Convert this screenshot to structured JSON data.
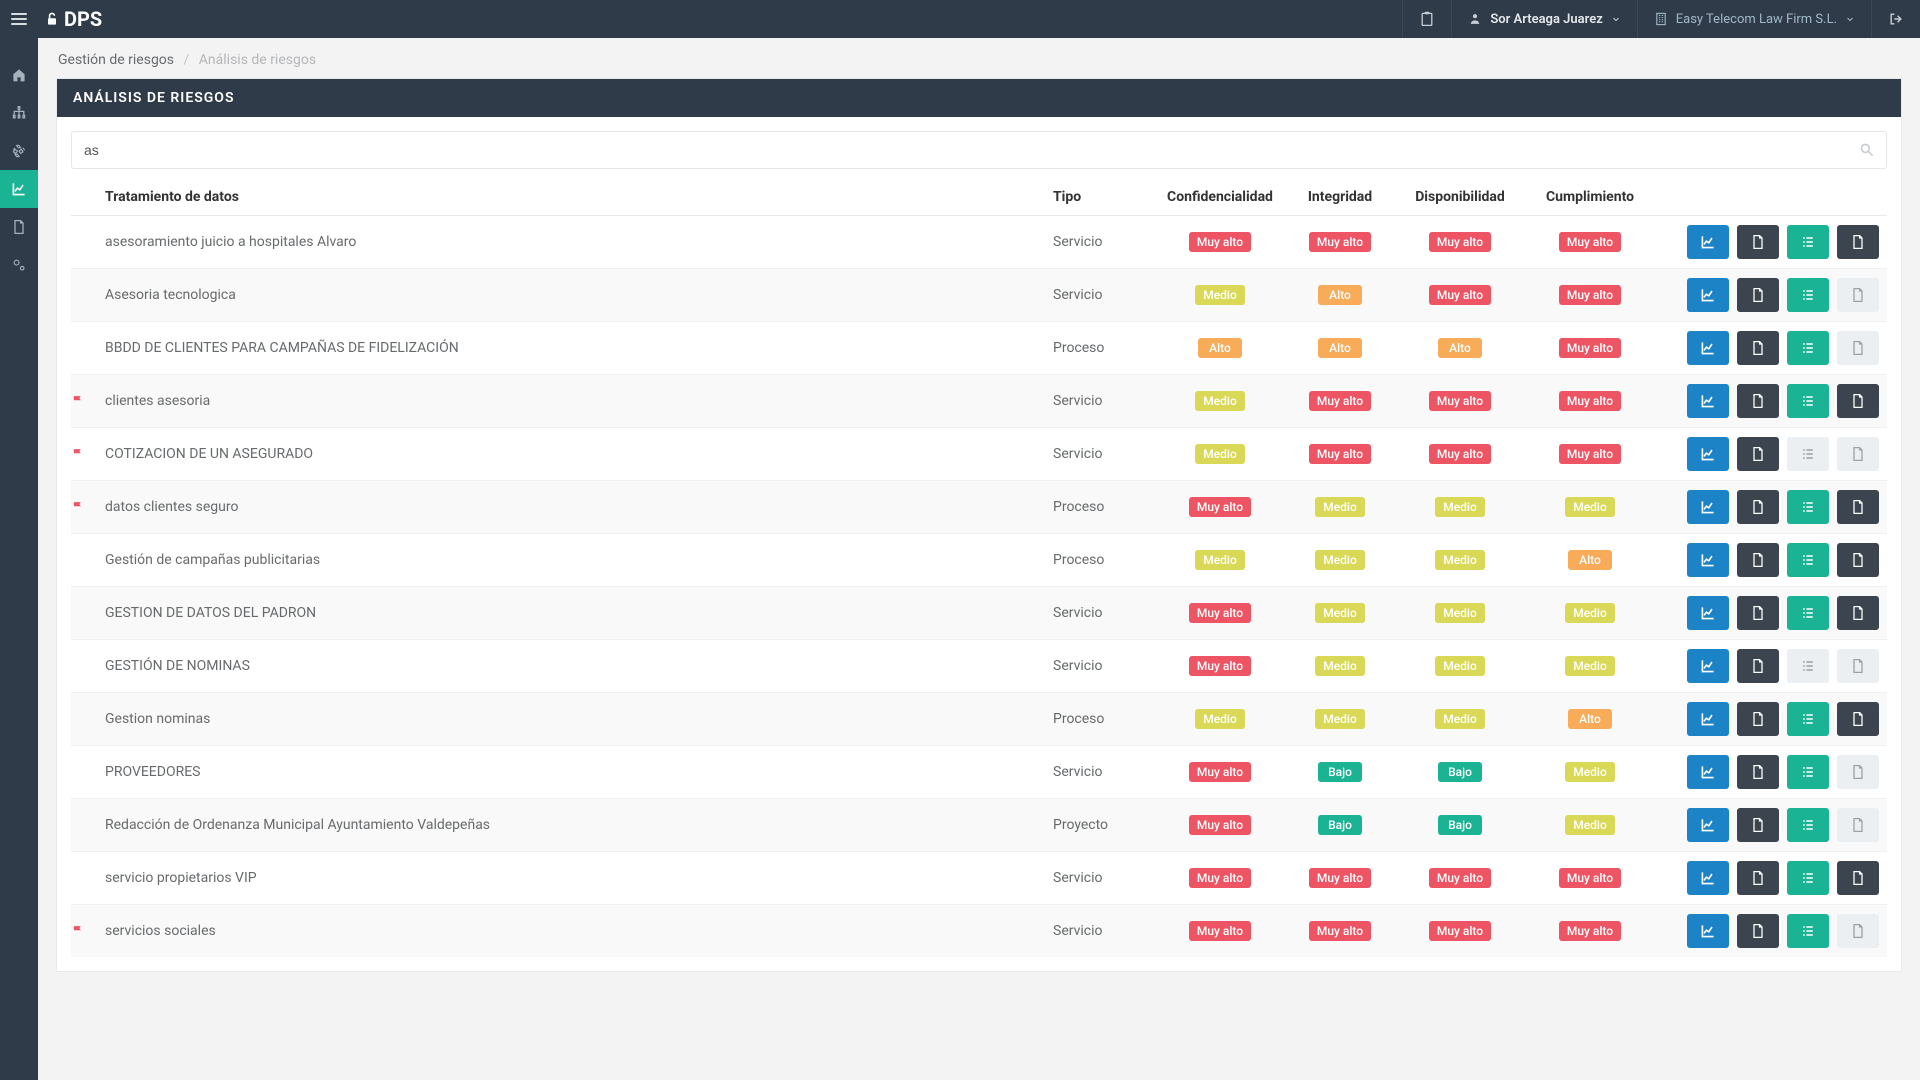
{
  "topbar": {
    "logo_text": "DPS",
    "user_name": "Sor Arteaga Juarez",
    "company_name": "Easy Telecom Law Firm S.L."
  },
  "breadcrumb": {
    "root": "Gestión de riesgos",
    "current": "Análisis de riesgos"
  },
  "panel": {
    "title": "ANÁLISIS DE RIESGOS",
    "search_value": "as"
  },
  "columns": {
    "tratamiento": "Tratamiento de datos",
    "tipo": "Tipo",
    "confidencialidad": "Confidencialidad",
    "integridad": "Integridad",
    "disponibilidad": "Disponibilidad",
    "cumplimiento": "Cumplimiento"
  },
  "risk_labels": {
    "muy-alto": "Muy alto",
    "alto": "Alto",
    "medio": "Medio",
    "bajo": "Bajo"
  },
  "rows": [
    {
      "flag": false,
      "name": "asesoramiento juicio a hospitales Alvaro",
      "tipo": "Servicio",
      "c": "muy-alto",
      "i": "muy-alto",
      "d": "muy-alto",
      "cu": "muy-alto",
      "a3": "green",
      "a4": "dark"
    },
    {
      "flag": false,
      "name": "Asesoria tecnologica",
      "tipo": "Servicio",
      "c": "medio",
      "i": "alto",
      "d": "muy-alto",
      "cu": "muy-alto",
      "a3": "green",
      "a4": "light"
    },
    {
      "flag": false,
      "name": "BBDD DE CLIENTES PARA CAMPAÑAS DE FIDELIZACIÓN",
      "tipo": "Proceso",
      "c": "alto",
      "i": "alto",
      "d": "alto",
      "cu": "muy-alto",
      "a3": "green",
      "a4": "light"
    },
    {
      "flag": true,
      "name": "clientes asesoria",
      "tipo": "Servicio",
      "c": "medio",
      "i": "muy-alto",
      "d": "muy-alto",
      "cu": "muy-alto",
      "a3": "green",
      "a4": "dark"
    },
    {
      "flag": true,
      "name": "COTIZACION DE UN ASEGURADO",
      "tipo": "Servicio",
      "c": "medio",
      "i": "muy-alto",
      "d": "muy-alto",
      "cu": "muy-alto",
      "a3": "light",
      "a4": "light"
    },
    {
      "flag": true,
      "name": "datos clientes seguro",
      "tipo": "Proceso",
      "c": "muy-alto",
      "i": "medio",
      "d": "medio",
      "cu": "medio",
      "a3": "green",
      "a4": "dark"
    },
    {
      "flag": false,
      "name": "Gestión de campañas publicitarias",
      "tipo": "Proceso",
      "c": "medio",
      "i": "medio",
      "d": "medio",
      "cu": "alto",
      "a3": "green",
      "a4": "dark"
    },
    {
      "flag": false,
      "name": "GESTION DE DATOS DEL PADRON",
      "tipo": "Servicio",
      "c": "muy-alto",
      "i": "medio",
      "d": "medio",
      "cu": "medio",
      "a3": "green",
      "a4": "dark"
    },
    {
      "flag": false,
      "name": "GESTIÓN DE NOMINAS",
      "tipo": "Servicio",
      "c": "muy-alto",
      "i": "medio",
      "d": "medio",
      "cu": "medio",
      "a3": "light",
      "a4": "light"
    },
    {
      "flag": false,
      "name": "Gestion nominas",
      "tipo": "Proceso",
      "c": "medio",
      "i": "medio",
      "d": "medio",
      "cu": "alto",
      "a3": "green",
      "a4": "dark"
    },
    {
      "flag": false,
      "name": "PROVEEDORES",
      "tipo": "Servicio",
      "c": "muy-alto",
      "i": "bajo",
      "d": "bajo",
      "cu": "medio",
      "a3": "green",
      "a4": "light"
    },
    {
      "flag": false,
      "name": "Redacción de Ordenanza Municipal Ayuntamiento Valdepeñas",
      "tipo": "Proyecto",
      "c": "muy-alto",
      "i": "bajo",
      "d": "bajo",
      "cu": "medio",
      "a3": "green",
      "a4": "light"
    },
    {
      "flag": false,
      "name": "servicio propietarios VIP",
      "tipo": "Servicio",
      "c": "muy-alto",
      "i": "muy-alto",
      "d": "muy-alto",
      "cu": "muy-alto",
      "a3": "green",
      "a4": "dark"
    },
    {
      "flag": true,
      "name": "servicios sociales",
      "tipo": "Servicio",
      "c": "muy-alto",
      "i": "muy-alto",
      "d": "muy-alto",
      "cu": "muy-alto",
      "a3": "green",
      "a4": "light"
    }
  ]
}
